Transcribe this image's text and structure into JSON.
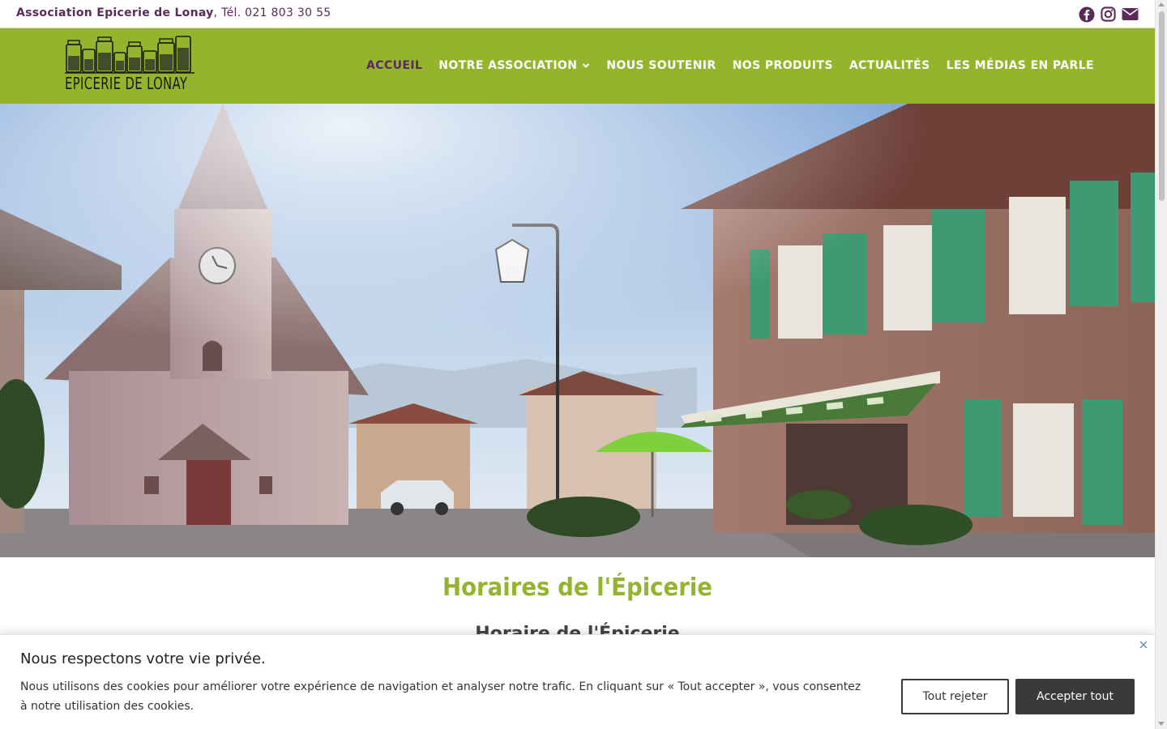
{
  "topbar": {
    "org_name": "Association Epicerie de Lonay",
    "phone": ", Tél. 021 803 30 55",
    "social": [
      "facebook-icon",
      "instagram-icon",
      "envelope-icon"
    ]
  },
  "logo": {
    "text": "EPICERIE DE LONAY"
  },
  "nav": {
    "items": [
      {
        "label": "ACCUEIL",
        "active": true
      },
      {
        "label": "NOTRE ASSOCIATION",
        "has_dropdown": true
      },
      {
        "label": "NOUS SOUTENIR"
      },
      {
        "label": "NOS PRODUITS"
      },
      {
        "label": "ACTUALITÉS"
      },
      {
        "label": "LES MÉDIAS EN PARLE"
      }
    ]
  },
  "content": {
    "title": "Horaires de l'Épicerie",
    "subtitle": "Horaire de l'Épicerie"
  },
  "cookie": {
    "heading": "Nous respectons votre vie privée.",
    "text": "Nous utilisons des cookies pour améliorer votre expérience de navigation et analyser notre trafic. En cliquant sur « Tout accepter », vous consentez à notre utilisation des cookies.",
    "reject_label": "Tout rejeter",
    "accept_label": "Accepter tout"
  },
  "colors": {
    "brand_green": "#95b42d",
    "accent_purple": "#5a2a5a",
    "dark_button": "#3a3a3a"
  }
}
